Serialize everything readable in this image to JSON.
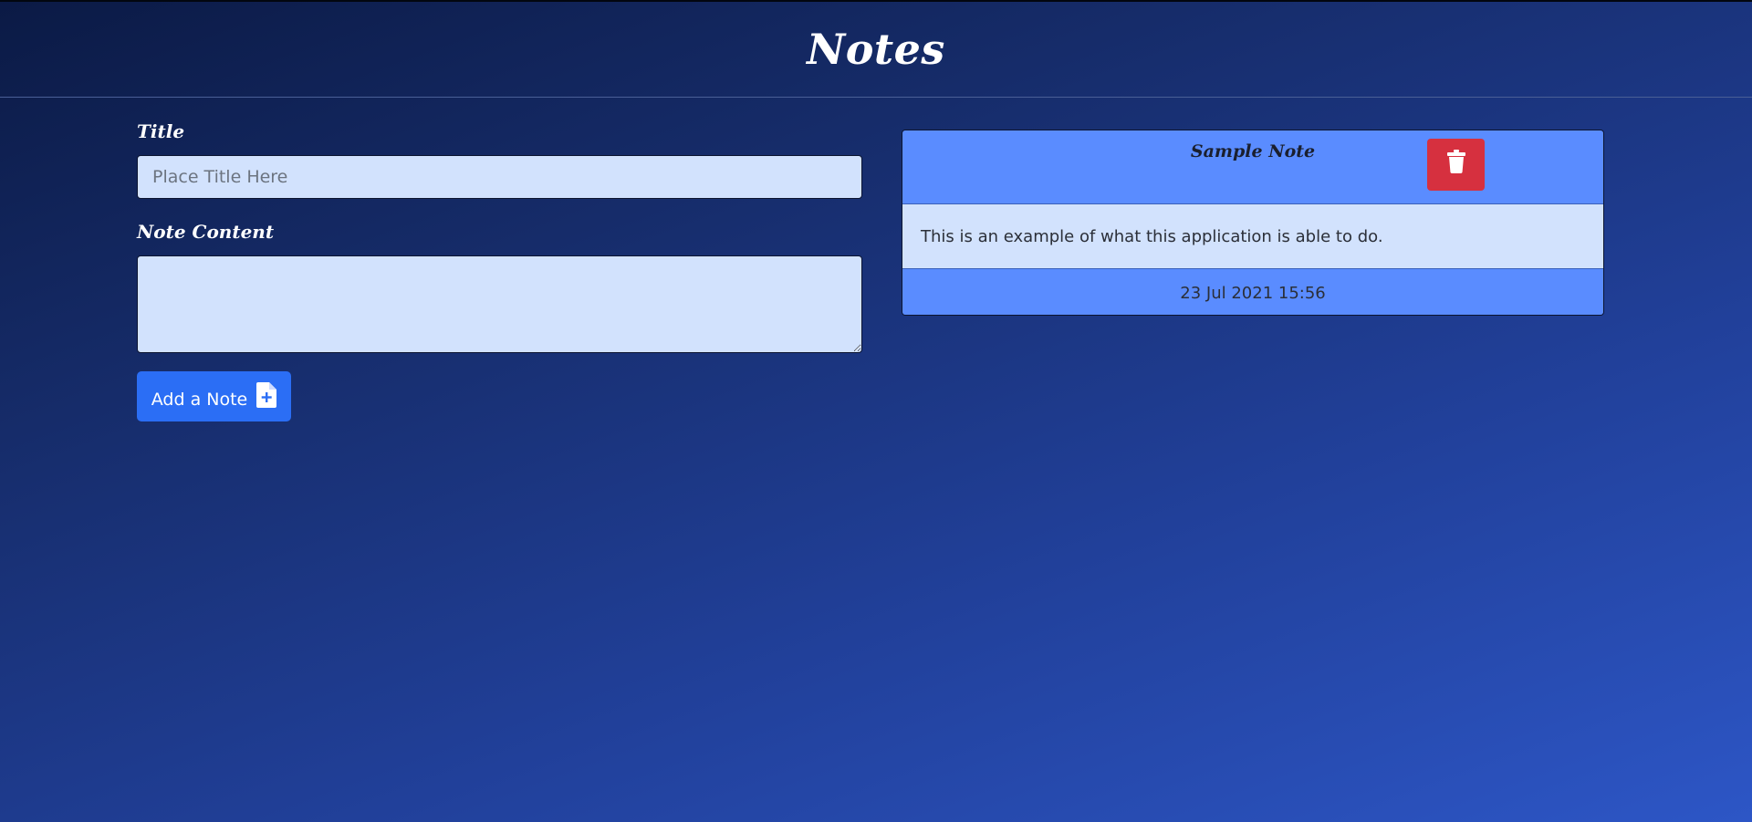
{
  "header": {
    "title": "Notes"
  },
  "form": {
    "title_label": "Title",
    "title_placeholder": "Place Title Here",
    "title_value": "",
    "content_label": "Note Content",
    "content_value": "",
    "add_button_label": "Add a Note",
    "add_button_icon": "file-plus-icon"
  },
  "notes": [
    {
      "title": "Sample Note",
      "content": "This is an example of what this application is able to do.",
      "date": "23 Jul 2021 15:56",
      "delete_icon": "trash-icon"
    }
  ],
  "colors": {
    "background_start": "#0b1a45",
    "background_end": "#2d56c6",
    "input_bg": "#d2e2fd",
    "primary_button": "#2b6ef5",
    "note_header": "#5a8cff",
    "delete_button": "#d6303f"
  }
}
